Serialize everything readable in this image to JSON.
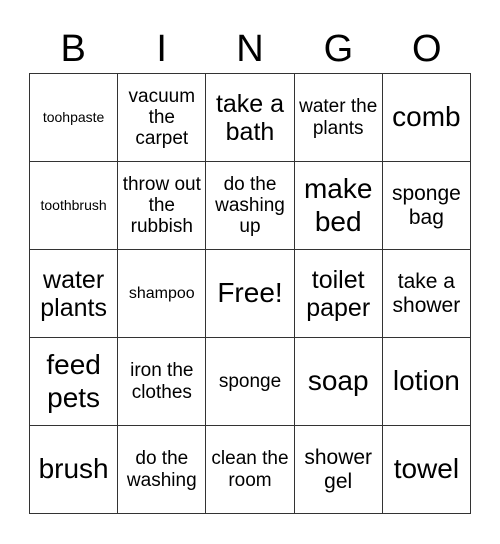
{
  "header": [
    "B",
    "I",
    "N",
    "G",
    "O"
  ],
  "cells": [
    [
      "toohpaste",
      "vacuum the carpet",
      "take a bath",
      "water the plants",
      "comb"
    ],
    [
      "toothbrush",
      "throw out the rubbish",
      "do the washing up",
      "make bed",
      "sponge bag"
    ],
    [
      "water plants",
      "shampoo",
      "Free!",
      "toilet paper",
      "take a shower"
    ],
    [
      "feed pets",
      "iron the clothes",
      "sponge",
      "soap",
      "lotion"
    ],
    [
      "brush",
      "do the washing",
      "clean the room",
      "shower gel",
      "towel"
    ]
  ]
}
